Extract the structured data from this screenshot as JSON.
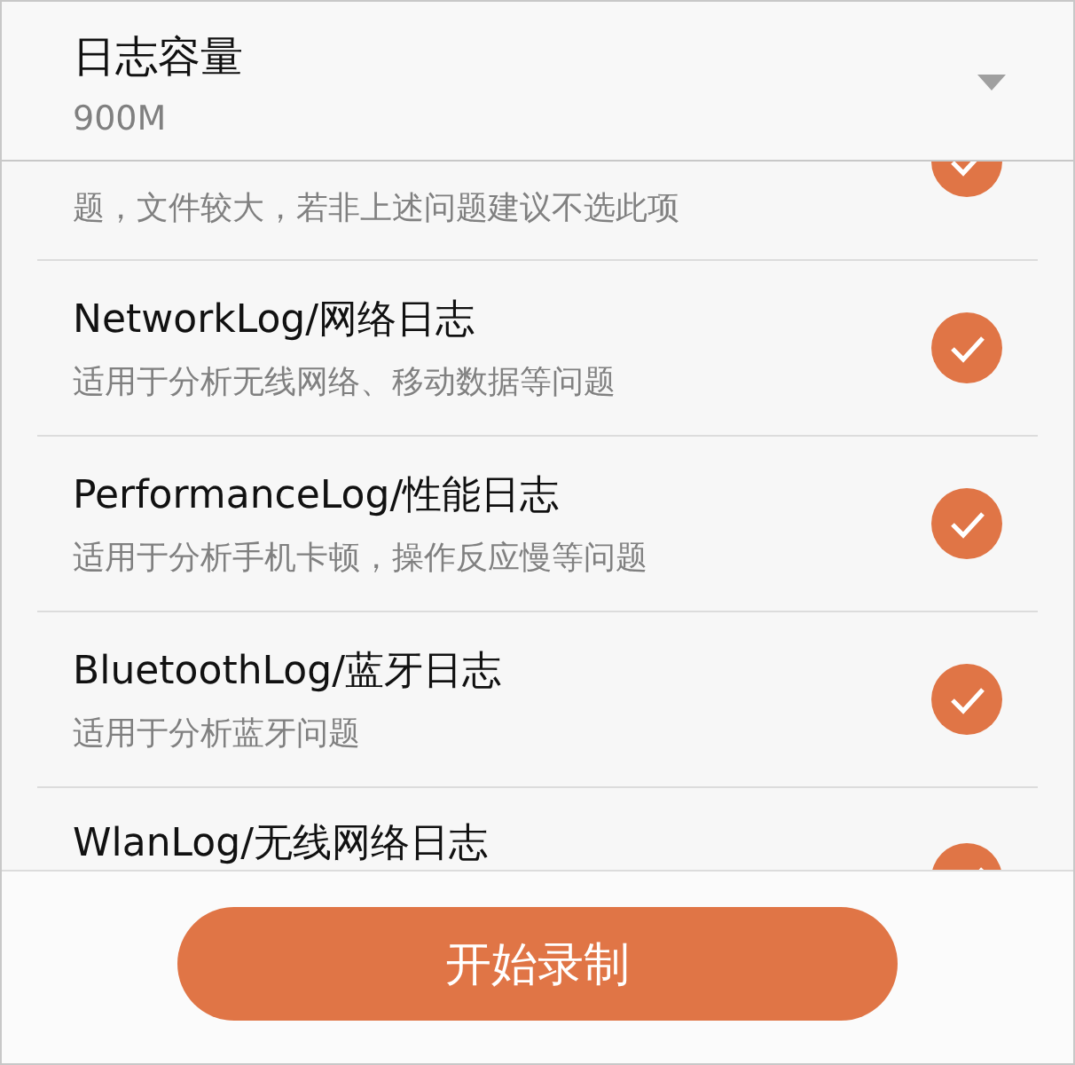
{
  "header": {
    "title": "日志容量",
    "value": "900M"
  },
  "items": [
    {
      "kind": "cut",
      "description": "题，文件较大，若非上述问题建议不选此项",
      "checked": true
    },
    {
      "kind": "full",
      "title": "NetworkLog/网络日志",
      "description": "适用于分析无线网络、移动数据等问题",
      "checked": true
    },
    {
      "kind": "full",
      "title": "PerformanceLog/性能日志",
      "description": "适用于分析手机卡顿，操作反应慢等问题",
      "checked": true
    },
    {
      "kind": "full",
      "title": "BluetoothLog/蓝牙日志",
      "description": "适用于分析蓝牙问题",
      "checked": true
    },
    {
      "kind": "partial",
      "title": "WlanLog/无线网络日志",
      "checked": true
    }
  ],
  "button": "开始录制"
}
